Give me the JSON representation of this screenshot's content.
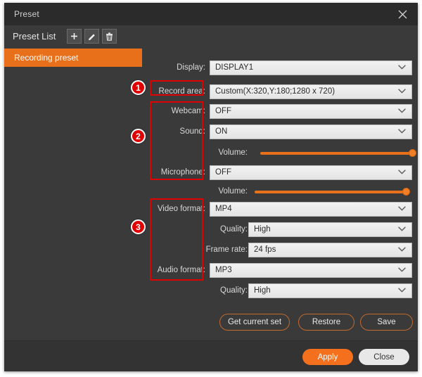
{
  "window": {
    "title": "Preset",
    "close_icon": "close-icon"
  },
  "sidebar": {
    "header": "Preset List",
    "tools": [
      {
        "name": "add-preset",
        "icon": "plus-icon"
      },
      {
        "name": "edit-preset",
        "icon": "pencil-icon"
      },
      {
        "name": "delete-preset",
        "icon": "trash-icon"
      }
    ],
    "items": [
      {
        "label": "Recording preset",
        "selected": true
      }
    ]
  },
  "settings": {
    "display": {
      "label": "Display:",
      "value": "DISPLAY1"
    },
    "record_area": {
      "label": "Record area:",
      "value": "Custom(X:320,Y:180;1280 x 720)"
    },
    "webcam": {
      "label": "Webcam:",
      "value": "OFF"
    },
    "sound": {
      "label": "Sound:",
      "value": "ON"
    },
    "sound_volume": {
      "label": "Volume:",
      "value": 100
    },
    "microphone": {
      "label": "Microphone:",
      "value": "OFF"
    },
    "microphone_volume": {
      "label": "Volume:",
      "value": 100
    },
    "video_format": {
      "label": "Video format:",
      "value": "MP4"
    },
    "video_quality": {
      "label": "Quality:",
      "value": "High"
    },
    "frame_rate": {
      "label": "Frame rate:",
      "value": "24 fps"
    },
    "audio_format": {
      "label": "Audio format:",
      "value": "MP3"
    },
    "audio_quality": {
      "label": "Quality:",
      "value": "High"
    }
  },
  "actions": {
    "get_current_set": "Get current set",
    "restore": "Restore",
    "save": "Save"
  },
  "footer": {
    "apply": "Apply",
    "close": "Close"
  },
  "annotations": {
    "badge_1": "1",
    "badge_2": "2",
    "badge_3": "3"
  },
  "colors": {
    "accent": "#e8701a",
    "apply": "#f4701c",
    "annotation": "#e00000",
    "panel": "#3a3a3a",
    "titlebar": "#2b2b2b"
  }
}
